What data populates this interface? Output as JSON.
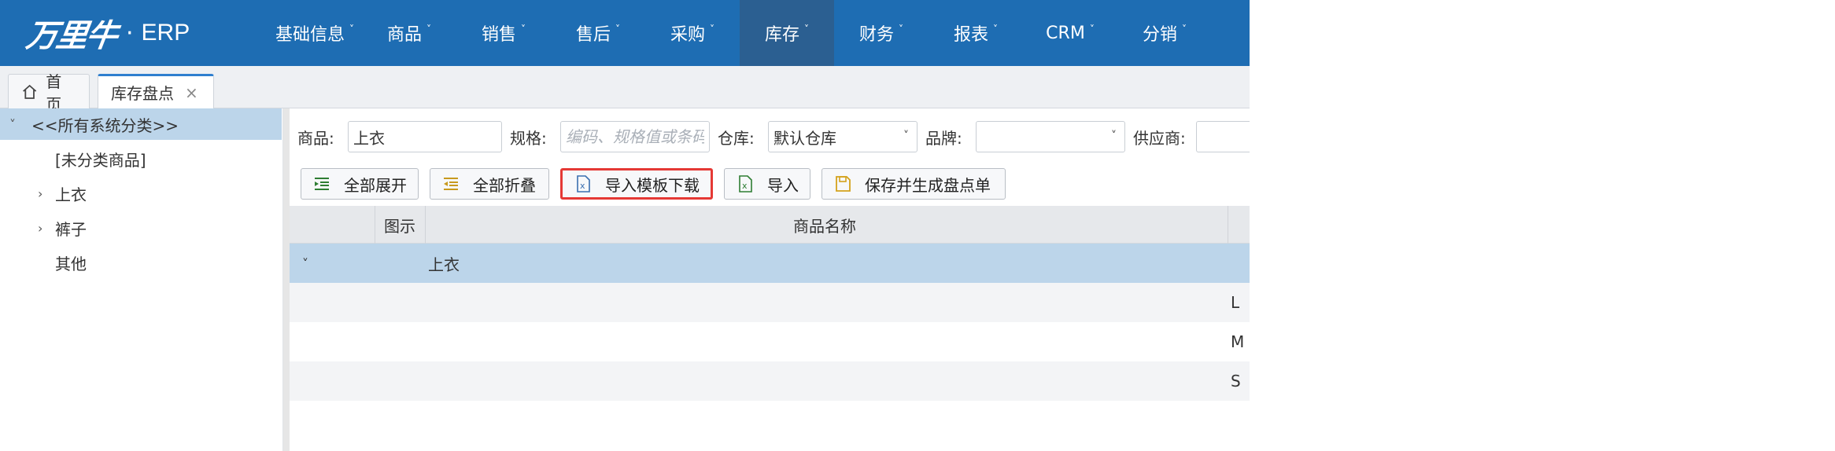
{
  "logo": {
    "brand": "万里牛",
    "dot": "·",
    "erp": "ERP"
  },
  "nav": [
    {
      "label": "基础信息",
      "active": false
    },
    {
      "label": "商品",
      "active": false
    },
    {
      "label": "销售",
      "active": false
    },
    {
      "label": "售后",
      "active": false
    },
    {
      "label": "采购",
      "active": false
    },
    {
      "label": "库存",
      "active": true
    },
    {
      "label": "财务",
      "active": false
    },
    {
      "label": "报表",
      "active": false
    },
    {
      "label": "CRM",
      "active": false
    },
    {
      "label": "分销",
      "active": false
    }
  ],
  "tabs": {
    "home": "首页",
    "stock": "库存盘点",
    "close": "×"
  },
  "sidebar": {
    "items": [
      {
        "label": "<<所有系统分类>>",
        "chevron": "˅"
      },
      {
        "label": "[未分类商品]"
      },
      {
        "label": "上衣",
        "chevron": "›"
      },
      {
        "label": "裤子",
        "chevron": "›"
      },
      {
        "label": "其他"
      }
    ]
  },
  "filters": {
    "product_label": "商品:",
    "product_value": "上衣",
    "spec_label": "规格:",
    "spec_placeholder": "编码、规格值或条码",
    "warehouse_label": "仓库:",
    "warehouse_value": "默认仓库",
    "brand_label": "品牌:",
    "brand_value": "",
    "supplier_label": "供应商:"
  },
  "toolbar": {
    "expand_all": "全部展开",
    "collapse_all": "全部折叠",
    "import_template": "导入模板下载",
    "import": "导入",
    "save_generate": "保存并生成盘点单"
  },
  "grid": {
    "headers": {
      "image": "图示",
      "name": "商品名称"
    },
    "group": {
      "chevron": "˅",
      "name": "上衣"
    },
    "rows": [
      {
        "spec": "L"
      },
      {
        "spec": "M"
      },
      {
        "spec": "S"
      }
    ]
  },
  "colors": {
    "topbar": "#1e6db3",
    "nav_active": "#2b5f91",
    "selected_row": "#bcd5ea",
    "highlight_border": "#e53935"
  }
}
